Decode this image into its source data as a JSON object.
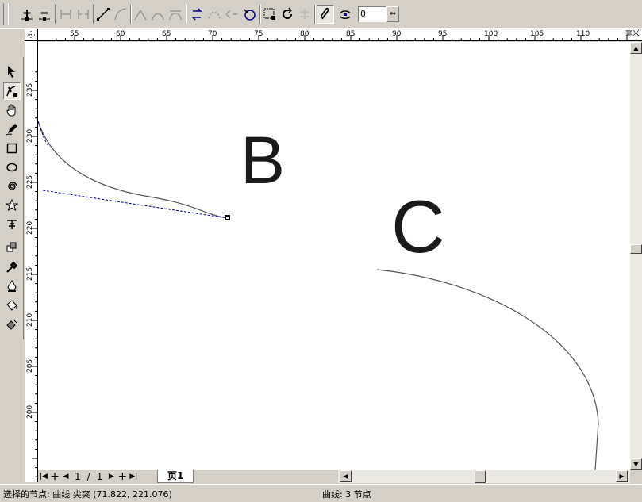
{
  "toolbar": {
    "buttons": [
      {
        "name": "add-node-button",
        "icon": "add-node-icon",
        "pressed": false
      },
      {
        "name": "delete-node-button",
        "icon": "delete-node-icon",
        "pressed": false
      },
      {
        "name": "join-nodes-button",
        "icon": "join-nodes-icon",
        "pressed": false
      },
      {
        "name": "break-curve-button",
        "icon": "break-curve-icon",
        "pressed": false
      },
      {
        "name": "to-line-button",
        "icon": "to-line-icon",
        "pressed": false
      },
      {
        "name": "to-curve-button",
        "icon": "to-curve-icon",
        "pressed": false
      },
      {
        "name": "cusp-node-button",
        "icon": "cusp-icon",
        "pressed": false
      },
      {
        "name": "smooth-node-button",
        "icon": "smooth-icon",
        "pressed": false
      },
      {
        "name": "symmetrical-node-button",
        "icon": "symmetrical-icon",
        "pressed": false
      },
      {
        "name": "reverse-direction-button",
        "icon": "reverse-icon",
        "pressed": false
      },
      {
        "name": "extend-curve-button",
        "icon": "extend-icon",
        "pressed": false
      },
      {
        "name": "extract-subpath-button",
        "icon": "extract-icon",
        "pressed": false
      },
      {
        "name": "auto-close-button",
        "icon": "auto-close-icon",
        "pressed": false
      },
      {
        "name": "stretch-scale-button",
        "icon": "stretch-icon",
        "pressed": false
      },
      {
        "name": "rotate-skew-button",
        "icon": "rotate-icon",
        "pressed": false
      },
      {
        "name": "align-nodes-button",
        "icon": "align-icon",
        "pressed": false
      },
      {
        "name": "elastic-mode-button",
        "icon": "elastic-icon",
        "pressed": true
      },
      {
        "name": "select-all-nodes-button",
        "icon": "select-all-icon",
        "pressed": false
      }
    ],
    "angle_value": "0",
    "spin_icon": "spin-icon"
  },
  "toolbox": {
    "tools": [
      {
        "name": "pick-tool",
        "icon": "arrow-icon",
        "pressed": false
      },
      {
        "name": "shape-tool",
        "icon": "shape-icon",
        "pressed": true
      },
      {
        "name": "pan-tool",
        "icon": "hand-icon",
        "pressed": false
      },
      {
        "name": "freehand-tool",
        "icon": "pencil-icon",
        "pressed": false
      },
      {
        "name": "rectangle-tool",
        "icon": "rectangle-icon",
        "pressed": false
      },
      {
        "name": "ellipse-tool",
        "icon": "ellipse-icon",
        "pressed": false
      },
      {
        "name": "spiral-tool",
        "icon": "spiral-icon",
        "pressed": false
      },
      {
        "name": "star-tool",
        "icon": "star-icon",
        "pressed": false
      },
      {
        "name": "text-tool",
        "icon": "text-icon",
        "pressed": false
      },
      {
        "name": "interactive-tool",
        "icon": "interactive-icon",
        "pressed": false
      },
      {
        "name": "eyedropper-tool",
        "icon": "eyedropper-icon",
        "pressed": false
      },
      {
        "name": "outline-tool",
        "icon": "pen-nib-icon",
        "pressed": false
      },
      {
        "name": "fill-tool",
        "icon": "bucket-icon",
        "pressed": false
      },
      {
        "name": "interactive-fill-tool",
        "icon": "interactive-fill-icon",
        "pressed": false
      }
    ]
  },
  "ruler": {
    "unit": "毫米",
    "top_ticks": [
      "55",
      "60",
      "65",
      "70",
      "75",
      "80",
      "85",
      "90",
      "95",
      "100",
      "105",
      "110"
    ],
    "left_ticks": [
      "235",
      "230",
      "225",
      "220",
      "215",
      "210",
      "205",
      "200"
    ]
  },
  "canvas": {
    "label_b": "B",
    "label_c": "C",
    "ink_color": "#1a1a1a",
    "control_line_color": "#0000aa"
  },
  "pages": {
    "current": "1",
    "total": "1",
    "separator": "/",
    "tab_label": "页1"
  },
  "status": {
    "left": "选择的节点: 曲线 尖突 (71.822, 221.076)",
    "right": "曲线: 3 节点"
  }
}
